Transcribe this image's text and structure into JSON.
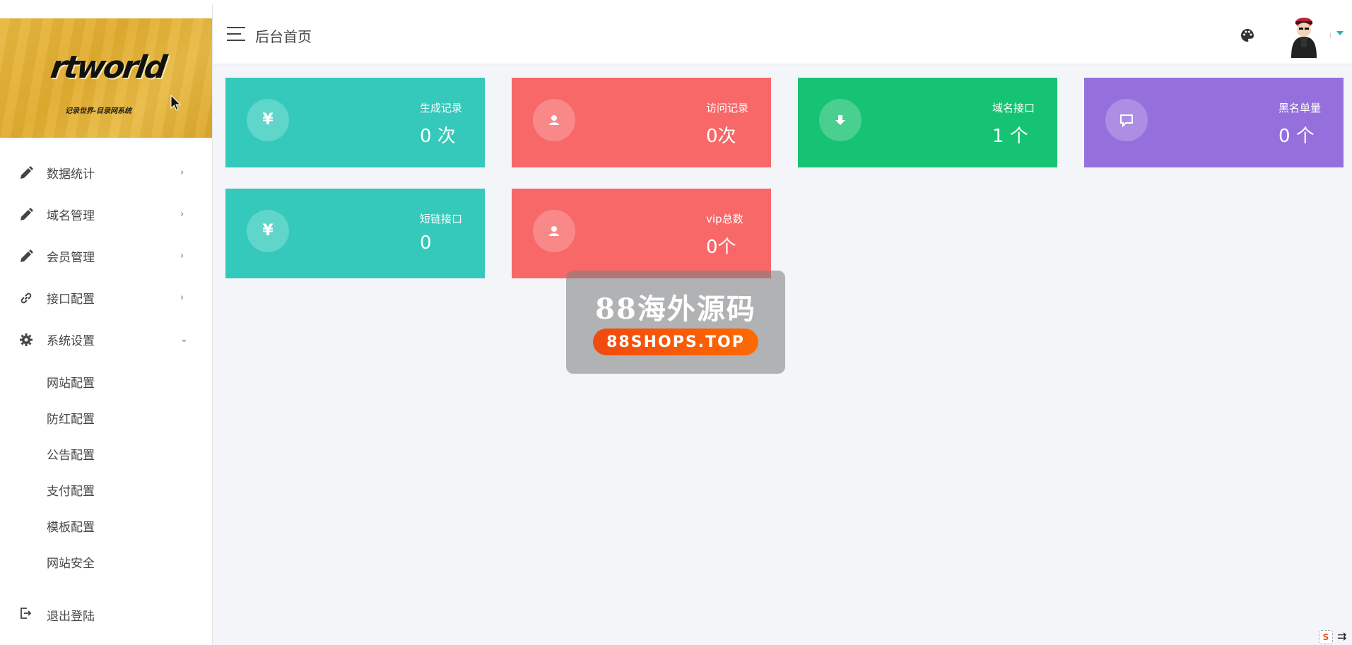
{
  "header": {
    "title": "后台首页",
    "menu_toggle_icon": "hamburger-icon",
    "theme_icon": "palette-icon",
    "avatar_icon": "user-avatar"
  },
  "sidebar": {
    "logo": {
      "text": "rtworld",
      "subtitle": "记录世界-目录网系统"
    },
    "items": [
      {
        "label": "数据统计",
        "icon": "pencil-icon",
        "arrow": "›"
      },
      {
        "label": "域名管理",
        "icon": "pencil-icon",
        "arrow": "›"
      },
      {
        "label": "会员管理",
        "icon": "pencil-icon",
        "arrow": "›"
      },
      {
        "label": "接口配置",
        "icon": "link-icon",
        "arrow": "›"
      },
      {
        "label": "系统设置",
        "icon": "gear-icon",
        "arrow": "⌄"
      }
    ],
    "submenu": [
      {
        "label": "网站配置"
      },
      {
        "label": "防红配置"
      },
      {
        "label": "公告配置"
      },
      {
        "label": "支付配置"
      },
      {
        "label": "模板配置"
      },
      {
        "label": "网站安全"
      }
    ],
    "logout": {
      "label": "退出登陆",
      "icon": "logout-icon"
    }
  },
  "cards": [
    {
      "label": "生成记录",
      "value": "0 次",
      "glyph": "¥",
      "icon": "yen-icon",
      "color": "#34c9ba"
    },
    {
      "label": "访问记录",
      "value": "0次",
      "glyph": "user",
      "icon": "user-icon",
      "color": "#f86868"
    },
    {
      "label": "域名接口",
      "value": "1 个",
      "glyph": "down",
      "icon": "download-icon",
      "color": "#16c372"
    },
    {
      "label": "黑名单量",
      "value": "0 个",
      "glyph": "chat",
      "icon": "message-icon",
      "color": "#9570dd"
    },
    {
      "label": "短链接口",
      "value": "0",
      "glyph": "¥",
      "icon": "yen-icon",
      "color": "#34c9ba"
    },
    {
      "label": "vip总数",
      "value": "0个",
      "glyph": "user",
      "icon": "user-icon",
      "color": "#f86868"
    }
  ],
  "watermark": {
    "title": "88海外源码",
    "url": "88SHOPS.TOP"
  },
  "corner": {
    "badge": "S",
    "glyph": "⇉"
  }
}
